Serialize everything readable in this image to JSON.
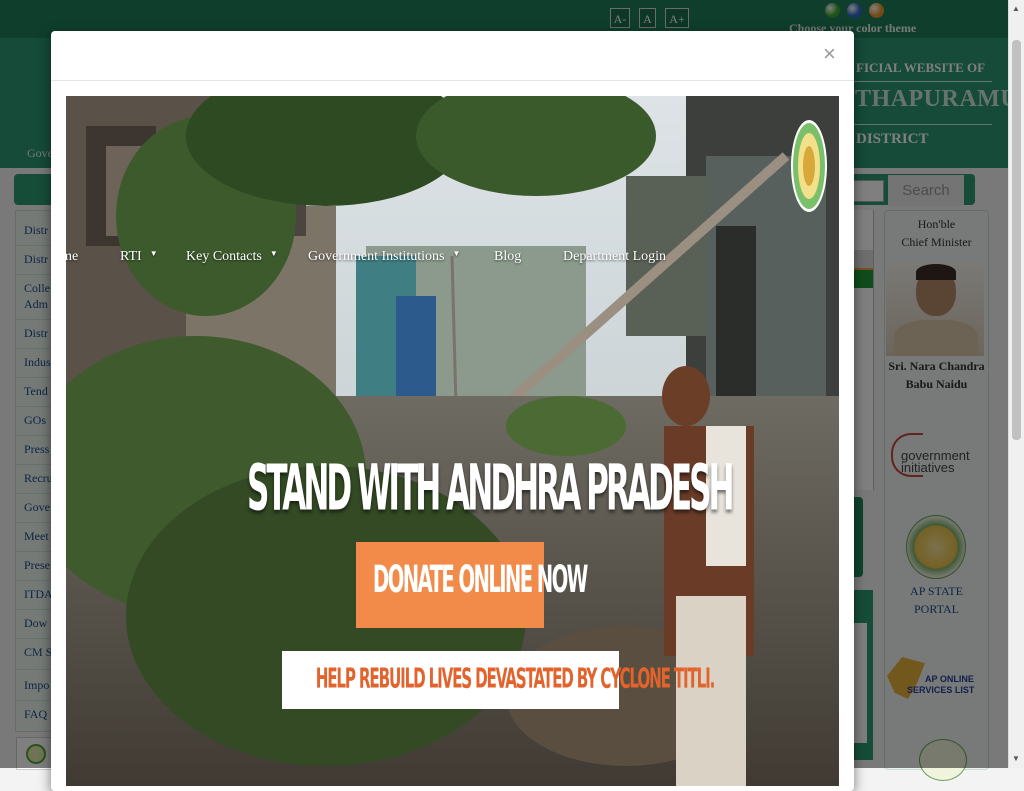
{
  "font_controls": [
    "A-",
    "A",
    "A+"
  ],
  "theme": {
    "label": "Choose your color theme",
    "colors": [
      "#3aa52c",
      "#2a66c8",
      "#e8932a"
    ]
  },
  "header": {
    "official_text": "FICIAL WEBSITE OF",
    "district_name": "THAPURAMU",
    "district_label": "DISTRICT",
    "left_text": "Gove"
  },
  "search": {
    "button_label": "Search"
  },
  "nav": {
    "items": [
      {
        "label": "Home",
        "dropdown": false
      },
      {
        "label": "RTI",
        "dropdown": true
      },
      {
        "label": "Key Contacts",
        "dropdown": true
      },
      {
        "label": "Government Institutions",
        "dropdown": true
      },
      {
        "label": "Blog",
        "dropdown": false
      },
      {
        "label": "Department Login",
        "dropdown": false
      }
    ]
  },
  "left_menu": {
    "items": [
      "Distr",
      "Distr",
      "Colle",
      "Adm",
      "Distr",
      "Indus",
      "Tend",
      "GOs",
      "Press",
      "Recru",
      "Gove",
      "Meet",
      "Prese",
      "ITDA",
      "Dow",
      "CM S",
      "Impo",
      "FAQ"
    ]
  },
  "right_sidebar": {
    "cm_title_line1": "Hon'ble",
    "cm_title_line2": "Chief Minister",
    "cm_name_line1": "Sri. Nara Chandra",
    "cm_name_line2": "Babu Naidu",
    "gov_initiatives_1": "government",
    "gov_initiatives_2": "initiatives",
    "ap_portal_line1": "AP STATE",
    "ap_portal_line2": "PORTAL",
    "ap_online_line1": "AP ONLINE",
    "ap_online_line2": "SERVICES LIST"
  },
  "modal": {
    "close_label": "×",
    "headline": "STAND WITH ANDHRA PRADESH",
    "donate_label": "DONATE ONLINE NOW",
    "rebuild_text": "HELP REBUILD LIVES DEVASTATED BY CYCLONE TITLI."
  }
}
